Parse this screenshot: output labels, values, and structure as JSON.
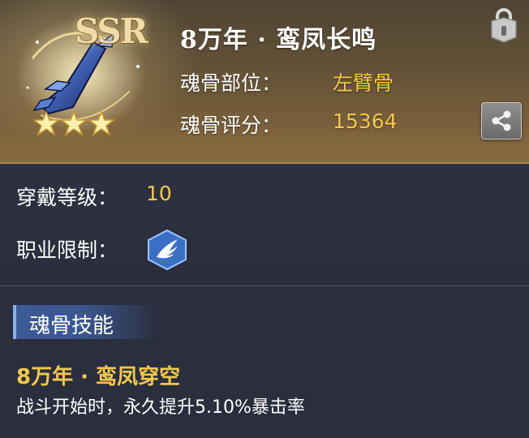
{
  "item": {
    "rarity": "SSR",
    "stars": 3,
    "name": "8万年 · 鸾凤长鸣",
    "slot_label": "魂骨部位：",
    "slot_value": "左臂骨",
    "score_label": "魂骨评分：",
    "score_value": "15364"
  },
  "requirements": {
    "level_label": "穿戴等级：",
    "level_value": "10",
    "class_label": "职业限制："
  },
  "skill": {
    "section_title": "魂骨技能",
    "name": "8万年 · 鸾凤穿空",
    "description": "战斗开始时，永久提升5.10%暴击率"
  },
  "icons": {
    "lock": "lock-icon",
    "share": "share-icon",
    "class": "wing-class-icon",
    "item": "soul-bone-arm-icon"
  },
  "colors": {
    "gold": "#f4c84f",
    "header_bg": "#6a5638",
    "panel_bg": "#2a2e3d",
    "tab_blue": "#3b5791"
  }
}
